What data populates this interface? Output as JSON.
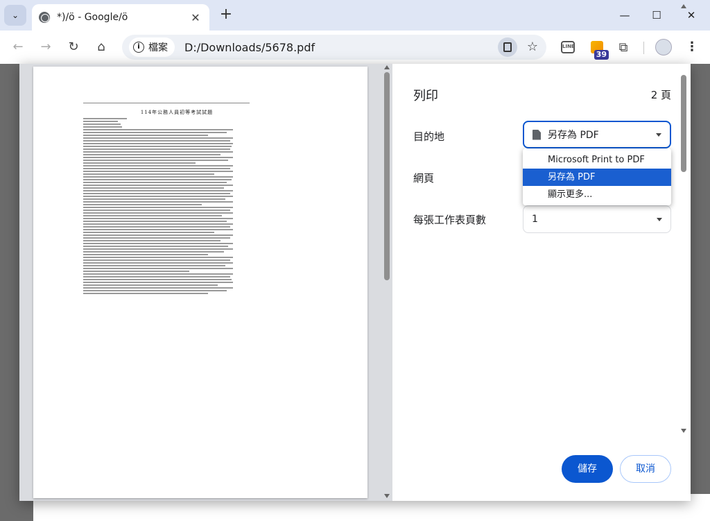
{
  "browser": {
    "tab_title": "*)/ö - Google/ö",
    "new_tab_symbol": "+",
    "close_symbol": "✕",
    "window": {
      "minimize": "—",
      "maximize": "☐",
      "close": "✕"
    },
    "nav": {
      "back": "←",
      "forward": "→",
      "reload": "↻",
      "home": "⌂"
    },
    "omnibox": {
      "site_info_label": "檔案",
      "url": "D:/Downloads/5678.pdf"
    },
    "star_symbol": "☆",
    "menu_symbol": "⋮",
    "puzzle_symbol": "⧉",
    "extensions": {
      "line_label": "LINE",
      "rss_badge": "39"
    }
  },
  "print_dialog": {
    "title": "列印",
    "page_count": "2 頁",
    "destination": {
      "label": "目的地",
      "value": "另存為 PDF",
      "options": [
        "Microsoft Print to PDF",
        "另存為 PDF",
        "顯示更多..."
      ],
      "selected_index": 1
    },
    "pages": {
      "label": "網頁"
    },
    "pages_per_sheet": {
      "label": "每張工作表頁數",
      "value": "1"
    },
    "buttons": {
      "save": "儲存",
      "cancel": "取消"
    }
  },
  "preview": {
    "heading": "114年公務人員初等考試試題"
  },
  "colors": {
    "accent": "#0b57d0",
    "selected_option": "#1a5fd0",
    "tabstrip": "#dfe6f5"
  }
}
